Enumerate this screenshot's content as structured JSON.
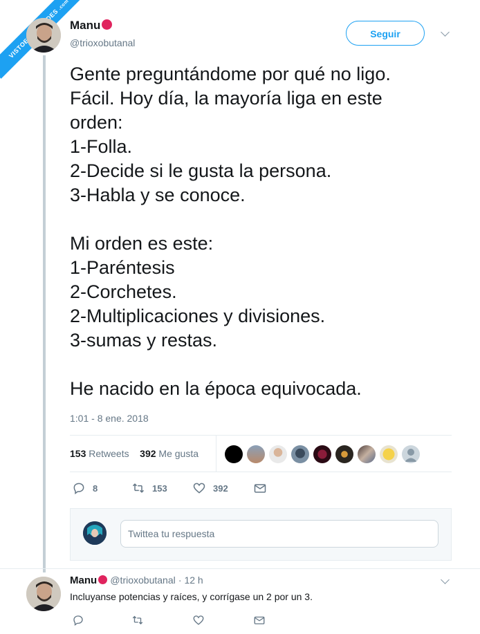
{
  "watermark": {
    "text": "VISTOENLASREDES",
    "suffix": ".com"
  },
  "tweet": {
    "author_name": "Manu",
    "author_handle": "@trioxobutanal",
    "follow_label": "Seguir",
    "lines": [
      "Gente preguntándome por qué no ligo.",
      "Fácil. Hoy día, la mayoría liga en este",
      "orden:",
      "1-Folla.",
      "2-Decide si le gusta la persona.",
      "3-Habla y se conoce.",
      "",
      "Mi orden es este:",
      "1-Paréntesis",
      "2-Corchetes.",
      "2-Multiplicaciones y divisiones.",
      "3-sumas y restas.",
      "",
      "He nacido en la época equivocada."
    ],
    "timestamp": "1:01 - 8 ene. 2018",
    "retweets_count": "153",
    "retweets_label": "Retweets",
    "likes_count": "392",
    "likes_label": "Me gusta",
    "actions": {
      "replies": "8",
      "retweets": "153",
      "likes": "392"
    }
  },
  "reply_box": {
    "placeholder": "Twittea tu respuesta"
  },
  "reply": {
    "author_name": "Manu",
    "author_handle": "@trioxobutanal",
    "time": "· 12 h",
    "text": "Incluyanse potencias y raíces,  y corrígase un 2 por un 3."
  },
  "colors": {
    "accent": "#1da1f2",
    "red_dot": "#e0245e",
    "muted": "#657786"
  }
}
